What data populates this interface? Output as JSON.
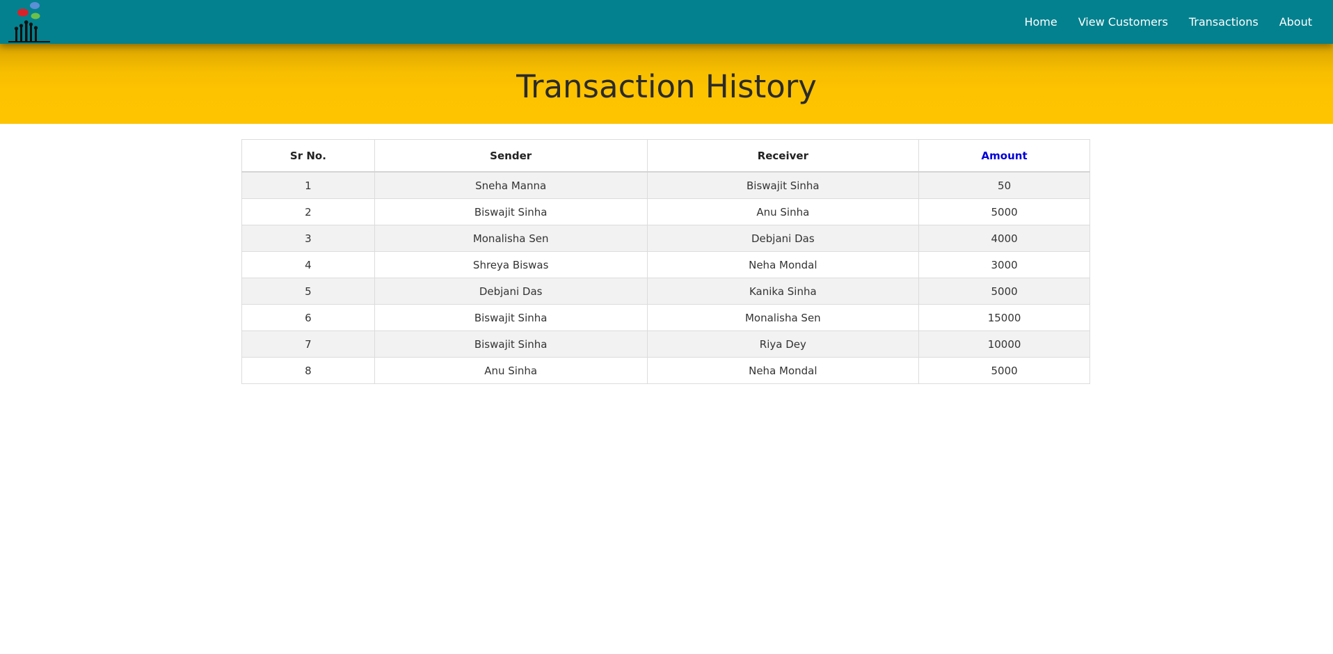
{
  "nav": {
    "logo_icon": "raised-hands-speech-bubbles-logo",
    "links": [
      {
        "label": "Home"
      },
      {
        "label": "View Customers"
      },
      {
        "label": "Transactions"
      },
      {
        "label": "About"
      }
    ]
  },
  "banner": {
    "title": "Transaction History"
  },
  "table": {
    "headers": {
      "sr": "Sr No.",
      "sender": "Sender",
      "receiver": "Receiver",
      "amount": "Amount"
    },
    "rows": [
      {
        "sr": "1",
        "sender": "Sneha Manna",
        "receiver": "Biswajit Sinha",
        "amount": "50"
      },
      {
        "sr": "2",
        "sender": "Biswajit Sinha",
        "receiver": "Anu Sinha",
        "amount": "5000"
      },
      {
        "sr": "3",
        "sender": "Monalisha Sen",
        "receiver": "Debjani Das",
        "amount": "4000"
      },
      {
        "sr": "4",
        "sender": "Shreya Biswas",
        "receiver": "Neha Mondal",
        "amount": "3000"
      },
      {
        "sr": "5",
        "sender": "Debjani Das",
        "receiver": "Kanika Sinha",
        "amount": "5000"
      },
      {
        "sr": "6",
        "sender": "Biswajit Sinha",
        "receiver": "Monalisha Sen",
        "amount": "15000"
      },
      {
        "sr": "7",
        "sender": "Biswajit Sinha",
        "receiver": "Riya Dey",
        "amount": "10000"
      },
      {
        "sr": "8",
        "sender": "Anu Sinha",
        "receiver": "Neha Mondal",
        "amount": "5000"
      }
    ]
  },
  "colors": {
    "navbar": "#03818f",
    "banner": "#fec300",
    "amount_header": "#0000d8",
    "stripe": "#f2f2f2"
  }
}
